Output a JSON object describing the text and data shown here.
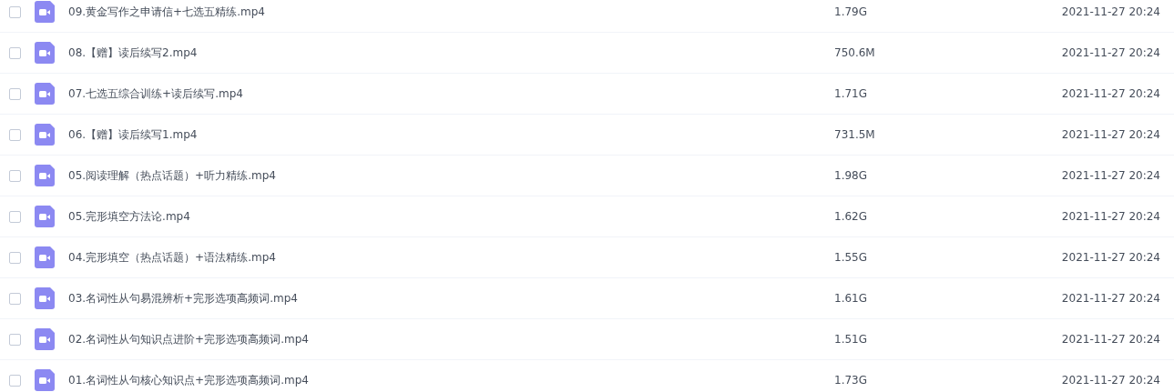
{
  "files": [
    {
      "name": "09.黄金写作之申请信+七选五精练.mp4",
      "size": "1.79G",
      "modified": "2021-11-27 20:24",
      "checked": false
    },
    {
      "name": "08.【赠】读后续写2.mp4",
      "size": "750.6M",
      "modified": "2021-11-27 20:24",
      "checked": false
    },
    {
      "name": "07.七选五综合训练+读后续写.mp4",
      "size": "1.71G",
      "modified": "2021-11-27 20:24",
      "checked": false
    },
    {
      "name": "06.【赠】读后续写1.mp4",
      "size": "731.5M",
      "modified": "2021-11-27 20:24",
      "checked": false
    },
    {
      "name": "05.阅读理解（热点话题）+听力精练.mp4",
      "size": "1.98G",
      "modified": "2021-11-27 20:24",
      "checked": false
    },
    {
      "name": "05.完形填空方法论.mp4",
      "size": "1.62G",
      "modified": "2021-11-27 20:24",
      "checked": false
    },
    {
      "name": "04.完形填空（热点话题）+语法精练.mp4",
      "size": "1.55G",
      "modified": "2021-11-27 20:24",
      "checked": false
    },
    {
      "name": "03.名词性从句易混辨析+完形选项高频词.mp4",
      "size": "1.61G",
      "modified": "2021-11-27 20:24",
      "checked": false
    },
    {
      "name": "02.名词性从句知识点进阶+完形选项高频词.mp4",
      "size": "1.51G",
      "modified": "2021-11-27 20:24",
      "checked": false
    },
    {
      "name": "01.名词性从句核心知识点+完形选项高频词.mp4",
      "size": "1.73G",
      "modified": "2021-11-27 20:24",
      "checked": false
    }
  ]
}
